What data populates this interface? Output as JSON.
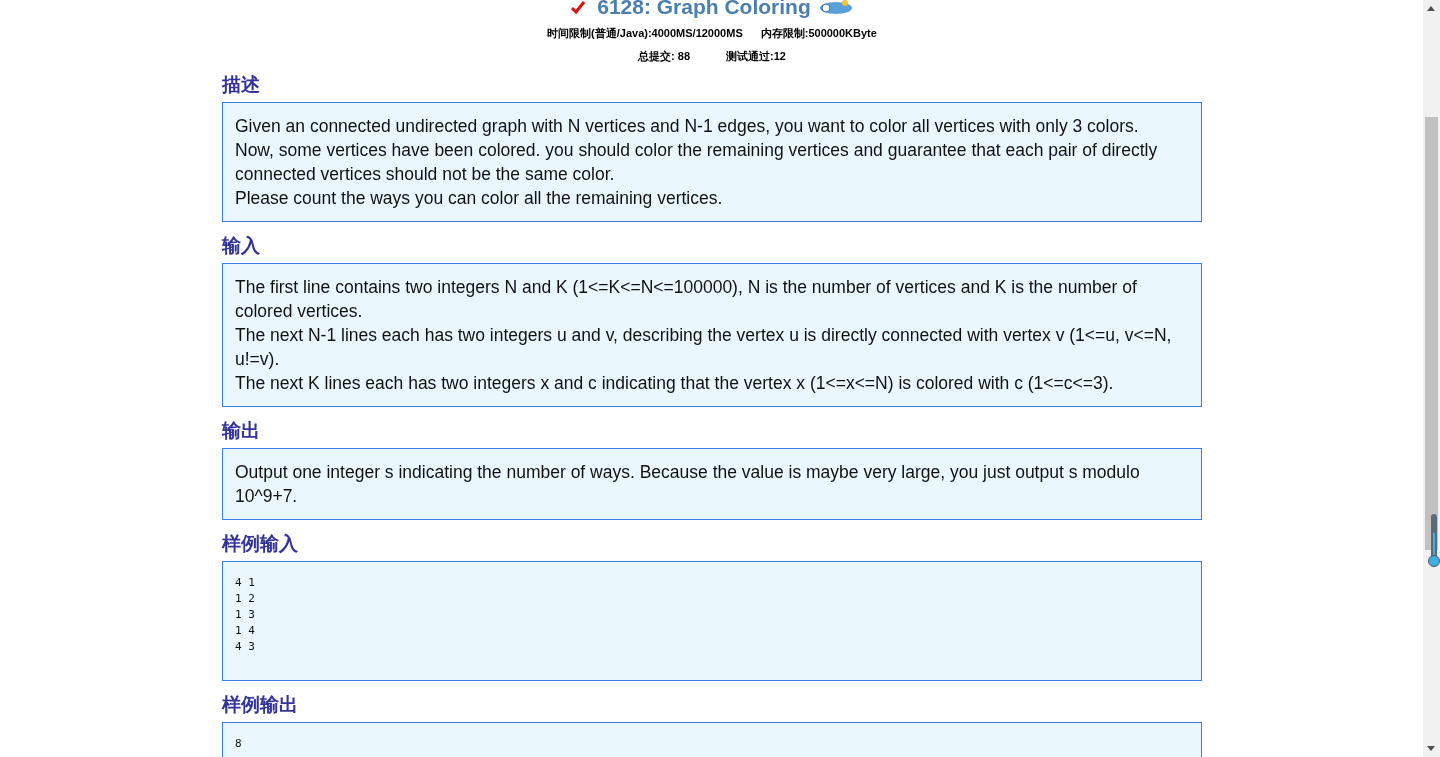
{
  "problem": {
    "solved": true,
    "title": "6128: Graph Coloring",
    "time_limit": "时间限制(普通/Java):4000MS/12000MS",
    "memory_limit": "内存限制:500000KByte",
    "submissions": "总提交: 88",
    "accepted": "测试通过:12"
  },
  "sections": [
    {
      "heading": "描述",
      "kind": "text",
      "paragraphs": [
        "Given an connected undirected graph with N vertices and N-1 edges,  you want to color all vertices with only 3 colors.",
        "Now, some vertices have been colored. you should color the remaining vertices and guarantee that each pair of directly connected vertices should not be the same color.",
        "Please count the ways you can color all the remaining vertices."
      ]
    },
    {
      "heading": "输入",
      "kind": "text",
      "paragraphs": [
        "The first line contains two integers N and K (1<=K<=N<=100000),  N is the number of vertices and K is the number of colored vertices.",
        "The next N-1 lines each has two integers u and v, describing the vertex u is directly connected with vertex v (1<=u, v<=N, u!=v).",
        "The next K lines each has two integers x and c indicating that the vertex x (1<=x<=N) is colored with c (1<=c<=3)."
      ]
    },
    {
      "heading": "输出",
      "kind": "text",
      "paragraphs": [
        "Output one integer s indicating the number of ways. Because the value is maybe very large, you just output s modulo 10^9+7."
      ]
    },
    {
      "heading": "样例输入",
      "kind": "code",
      "lines": [
        "4 1",
        "1 2",
        "1 3",
        "1 4",
        "4 3"
      ]
    },
    {
      "heading": "样例输出",
      "kind": "code",
      "lines": [
        "8"
      ]
    }
  ]
}
